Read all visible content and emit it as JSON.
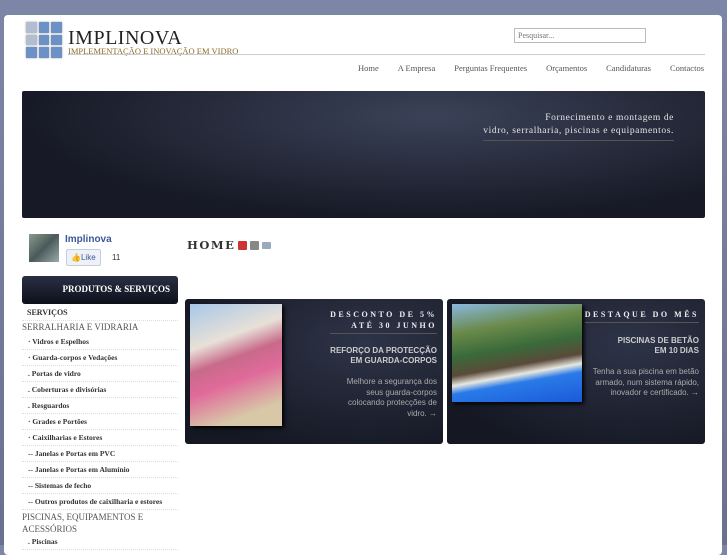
{
  "header": {
    "title": "IMPLINOVA",
    "subtitle": "IMPLEMENTAÇÃO E INOVAÇÃO EM VIDRO",
    "search_placeholder": "Pesquisar..."
  },
  "nav": [
    "Home",
    "A Empresa",
    "Perguntas Frequentes",
    "Orçamentos",
    "Candidaturas",
    "Contactos"
  ],
  "banner": {
    "line1": "Fornecimento e montagem de",
    "line2": "vidro, serralharia, piscinas e equipamentos."
  },
  "facebook": {
    "name": "Implinova",
    "like": "Like",
    "count": "11"
  },
  "sidebar": {
    "heading": "PRODUTOS & SERVIÇOS",
    "items": [
      {
        "label": "SERVIÇOS",
        "type": "top"
      },
      {
        "label": "SERRALHARIA E VIDRARIA",
        "type": "sec"
      },
      {
        "label": "· Vidros e Espelhos"
      },
      {
        "label": "· Guarda-corpos e Vedações"
      },
      {
        "label": ". Portas de vidro"
      },
      {
        "label": ". Coberturas e divisórias"
      },
      {
        "label": ". Resguardos"
      },
      {
        "label": "· Grades e Portões"
      },
      {
        "label": "· Caixilharias e Estores"
      },
      {
        "label": "-- Janelas e Portas em PVC"
      },
      {
        "label": "-- Janelas e Portas em Alumínio"
      },
      {
        "label": "-- Sistemas de fecho"
      },
      {
        "label": "-- Outros produtos de caixilharia e estores"
      },
      {
        "label": "PISCINAS, EQUIPAMENTOS E ACESSÓRIOS",
        "type": "sec"
      },
      {
        "label": ". Piscinas"
      }
    ]
  },
  "main": {
    "heading": "HOME"
  },
  "cards": [
    {
      "title1": "DESCONTO DE 5%",
      "title2": "ATÉ 30 JUNHO",
      "head1": "REFORÇO DA PROTECÇÃO",
      "head2": "EM GUARDA-CORPOS",
      "body": [
        "Melhore a segurança dos",
        "seus guarda-corpos",
        "colocando protecções de",
        "vidro. →"
      ]
    },
    {
      "title1": "DESTAQUE DO MÊS",
      "head1": "PISCINAS DE BETÃO",
      "head2": "EM 10 DIAS",
      "body": [
        "Tenha a sua piscina em betão",
        "armado, num sistema rápido,",
        "inovador e certificado. →"
      ]
    }
  ]
}
